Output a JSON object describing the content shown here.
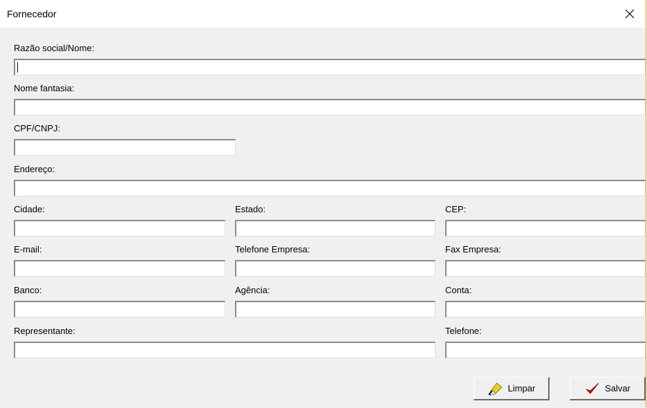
{
  "window": {
    "title": "Fornecedor"
  },
  "fields": {
    "razao_social": {
      "label": "Razão social/Nome:",
      "value": ""
    },
    "nome_fantasia": {
      "label": "Nome fantasia:",
      "value": ""
    },
    "cpf_cnpj": {
      "label": "CPF/CNPJ:",
      "value": ""
    },
    "endereco": {
      "label": "Endereço:",
      "value": ""
    },
    "cidade": {
      "label": "Cidade:",
      "value": ""
    },
    "estado": {
      "label": "Estado:",
      "value": ""
    },
    "cep": {
      "label": "CEP:",
      "value": ""
    },
    "email": {
      "label": "E-mail:",
      "value": ""
    },
    "telefone_empresa": {
      "label": "Telefone Empresa:",
      "value": ""
    },
    "fax_empresa": {
      "label": "Fax Empresa:",
      "value": ""
    },
    "banco": {
      "label": "Banco:",
      "value": ""
    },
    "agencia": {
      "label": "Agência:",
      "value": ""
    },
    "conta": {
      "label": "Conta:",
      "value": ""
    },
    "representante": {
      "label": "Representante:",
      "value": ""
    },
    "telefone": {
      "label": "Telefone:",
      "value": ""
    }
  },
  "buttons": {
    "limpar": {
      "label": "Limpar",
      "icon": "eraser-icon"
    },
    "salvar": {
      "label": "Salvar",
      "icon": "checkmark-icon",
      "icon_color": "#d01010"
    }
  }
}
